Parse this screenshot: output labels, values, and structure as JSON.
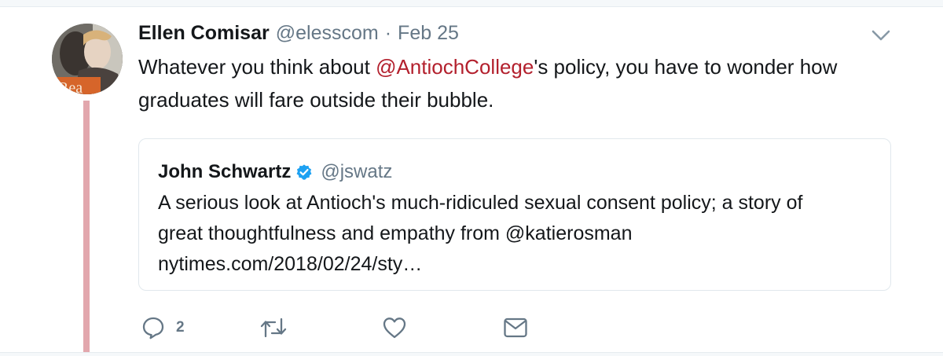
{
  "tweet": {
    "author_name": "Ellen Comisar",
    "author_handle": "@elesscom",
    "separator": "·",
    "date": "Feb 25",
    "text_before": "Whatever you think about ",
    "mention": "@AntiochCollege",
    "text_after": "'s policy, you have to wonder how graduates will fare outside their bubble.",
    "avatar_text": "Rea"
  },
  "quote": {
    "author_name": "John Schwartz",
    "author_handle": "@jswatz",
    "line1": "A serious look at Antioch's much-ridiculed sexual consent policy; a story of",
    "line2": "great thoughtfulness and empathy from @katierosman",
    "line3": "nytimes.com/2018/02/24/sty…"
  },
  "actions": {
    "reply_count": "2",
    "icons": [
      "reply-icon",
      "retweet-icon",
      "like-icon",
      "message-icon"
    ]
  },
  "colors": {
    "accent": "#b3202d",
    "thread_line": "#e2a7ad",
    "verified": "#1da1f2",
    "muted": "#657786"
  }
}
